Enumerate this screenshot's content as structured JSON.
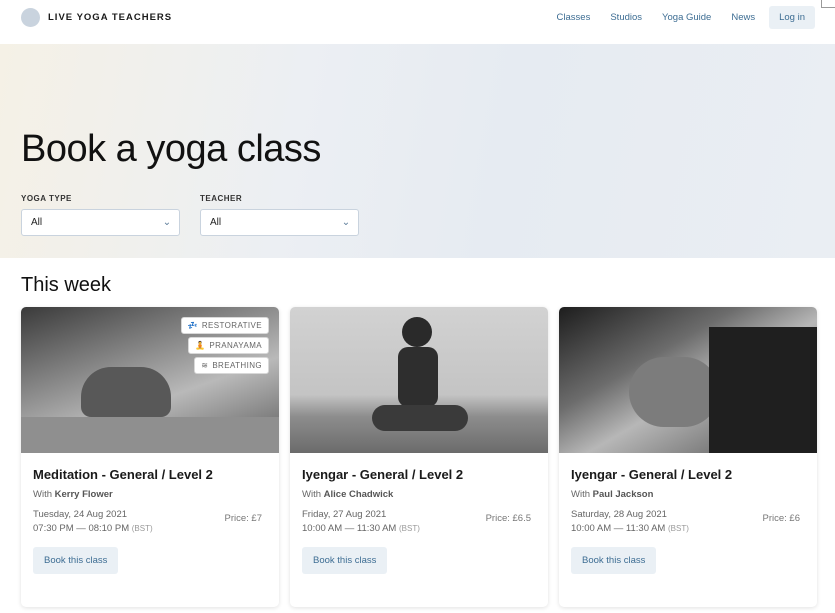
{
  "header": {
    "brand": "LIVE YOGA TEACHERS",
    "nav": [
      {
        "label": "Classes"
      },
      {
        "label": "Studios"
      },
      {
        "label": "Yoga Guide"
      },
      {
        "label": "News"
      }
    ],
    "login_label": "Log in"
  },
  "hero": {
    "title": "Book a yoga class",
    "filters": [
      {
        "label": "YOGA TYPE",
        "value": "All"
      },
      {
        "label": "TEACHER",
        "value": "All"
      }
    ]
  },
  "section": {
    "title": "This week"
  },
  "cards": [
    {
      "title": "Meditation - General / Level 2",
      "teacher_prefix": "With",
      "teacher": "Kerry Flower",
      "date": "Tuesday, 24 Aug 2021",
      "time": "07:30 PM — 08:10 PM",
      "tz": "(BST)",
      "price": "Price: £7",
      "button": "Book this class",
      "tags": [
        {
          "label": "RESTORATIVE",
          "icon": "zzz-icon",
          "glyph": "💤"
        },
        {
          "label": "PRANAYAMA",
          "icon": "meditation-icon",
          "glyph": "🧘"
        },
        {
          "label": "BREATHING",
          "icon": "breath-icon",
          "glyph": "≋"
        }
      ]
    },
    {
      "title": "Iyengar - General / Level 2",
      "teacher_prefix": "With",
      "teacher": "Alice Chadwick",
      "date": "Friday, 27 Aug 2021",
      "time": "10:00 AM — 11:30 AM",
      "tz": "(BST)",
      "price": "Price: £6.5",
      "button": "Book this class"
    },
    {
      "title": "Iyengar - General / Level 2",
      "teacher_prefix": "With",
      "teacher": "Paul Jackson",
      "date": "Saturday, 28 Aug 2021",
      "time": "10:00 AM — 11:30 AM",
      "tz": "(BST)",
      "price": "Price: £6",
      "button": "Book this class"
    }
  ],
  "colors": {
    "accent": "#3d6d93",
    "button_bg": "#eaf0f5"
  }
}
